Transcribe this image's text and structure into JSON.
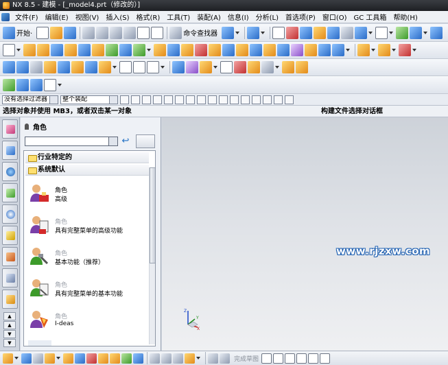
{
  "window": {
    "title": "NX 8.5 - 建模 - [_model4.prt（修改的）]"
  },
  "menubar": {
    "items": [
      {
        "label": "文件(F)"
      },
      {
        "label": "编辑(E)"
      },
      {
        "label": "视图(V)"
      },
      {
        "label": "插入(S)"
      },
      {
        "label": "格式(R)"
      },
      {
        "label": "工具(T)"
      },
      {
        "label": "装配(A)"
      },
      {
        "label": "信息(I)"
      },
      {
        "label": "分析(L)"
      },
      {
        "label": "首选项(P)"
      },
      {
        "label": "窗口(O)"
      },
      {
        "label": "GC 工具箱"
      },
      {
        "label": "帮助(H)"
      }
    ]
  },
  "toolbar": {
    "start_label": "开始·",
    "command_finder_label": "命令查找器"
  },
  "selection_bar": {
    "filter_value": "没有选择过滤器",
    "scope_value": "整个装配"
  },
  "status": {
    "cue": "选择对象并使用 MB3，或者双击某一对象",
    "message": "构建文件选择对话框"
  },
  "role_panel": {
    "title": "角色",
    "folder_industry": "行业特定的",
    "folder_default": "系统默认",
    "roles": [
      {
        "name": "角色",
        "desc": "高级"
      },
      {
        "name": "角色",
        "desc": "具有完整菜单的高级功能"
      },
      {
        "name": "角色",
        "desc": "基本功能（推荐）"
      },
      {
        "name": "角色",
        "desc": "具有完整菜单的基本功能"
      },
      {
        "name": "角色",
        "desc": "I-deas"
      }
    ]
  },
  "graphics": {
    "watermark": "www.rjzxw.com",
    "triad_z": "Z",
    "triad_x": "X",
    "triad_y": "Y"
  },
  "bottom_toolbar": {
    "finish_sketch_label": "完成草图"
  },
  "colors": {
    "accent": "#1b5db0",
    "titlebar": "#2a2d32",
    "folder": "#ffe070"
  }
}
